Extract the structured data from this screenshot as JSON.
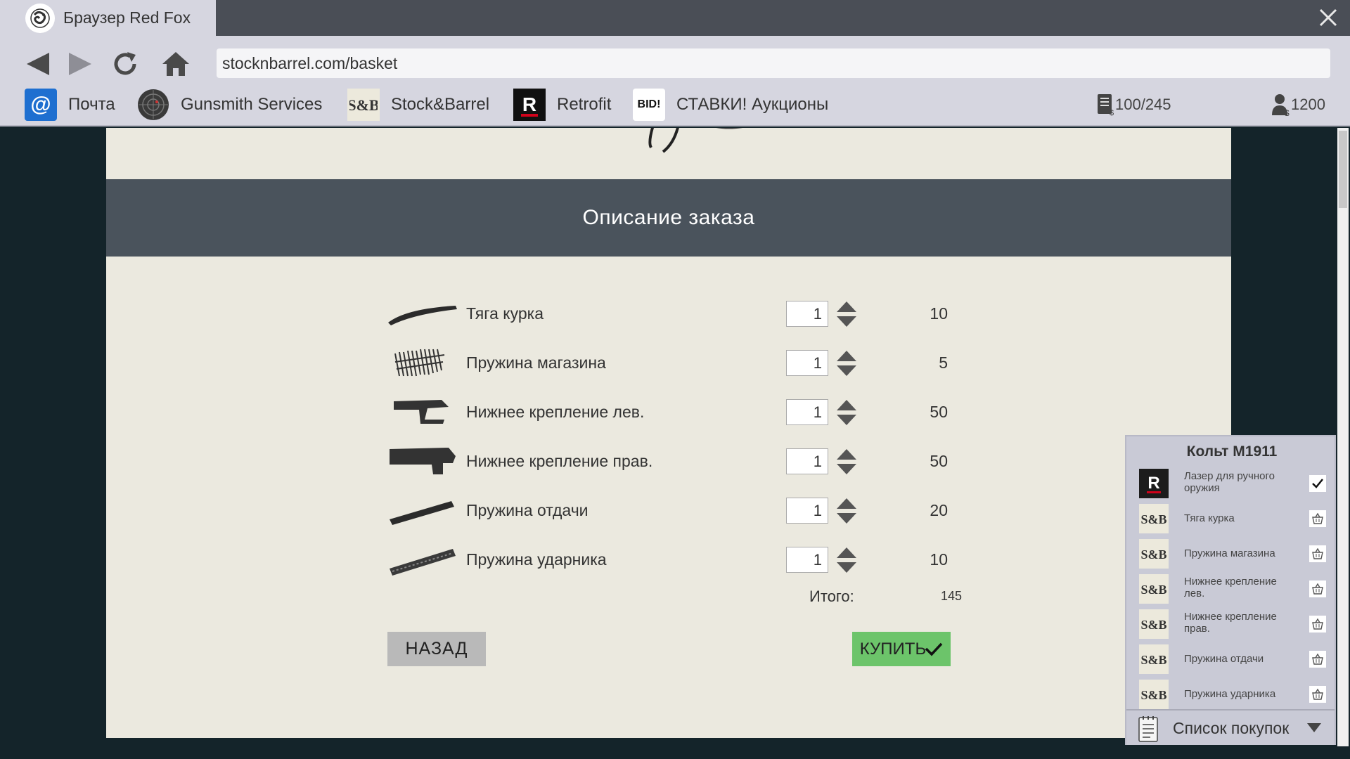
{
  "browser": {
    "tab_title": "Браузер Red Fox",
    "url": "stocknbarrel.com/basket"
  },
  "bookmarks": [
    {
      "label": "Почта",
      "icon": "at-mail-icon"
    },
    {
      "label": "Gunsmith Services",
      "icon": "target-icon"
    },
    {
      "label": "Stock&Barrel",
      "icon": "sb-logo-icon"
    },
    {
      "label": "Retrofit",
      "icon": "retrofit-r-icon"
    },
    {
      "label": "СТАВКИ! Аукционы",
      "icon": "bid-icon",
      "icon_text": "BID!"
    }
  ],
  "stats": {
    "storage": "100/245",
    "money": "1200"
  },
  "order": {
    "title": "Описание заказа",
    "items": [
      {
        "name": "Тяга курка",
        "qty": "1",
        "price": "10"
      },
      {
        "name": "Пружина магазина",
        "qty": "1",
        "price": "5"
      },
      {
        "name": "Нижнее крепление лев.",
        "qty": "1",
        "price": "50"
      },
      {
        "name": "Нижнее крепление прав.",
        "qty": "1",
        "price": "50"
      },
      {
        "name": "Пружина отдачи",
        "qty": "1",
        "price": "20"
      },
      {
        "name": "Пружина ударника",
        "qty": "1",
        "price": "10"
      }
    ],
    "total_label": "Итого:",
    "total_value": "145",
    "back_label": "НАЗАД",
    "buy_label": "КУПИТЬ"
  },
  "shopping_panel": {
    "title": "Кольт M1911",
    "items": [
      {
        "label": "Лазер для ручного оружия",
        "shop": "Retrofit",
        "status": "checked"
      },
      {
        "label": "Тяга курка",
        "shop": "Stock&Barrel",
        "status": "basket"
      },
      {
        "label": "Пружина магазина",
        "shop": "Stock&Barrel",
        "status": "basket"
      },
      {
        "label": "Нижнее крепление лев.",
        "shop": "Stock&Barrel",
        "status": "basket"
      },
      {
        "label": "Нижнее крепление прав.",
        "shop": "Stock&Barrel",
        "status": "basket"
      },
      {
        "label": "Пружина отдачи",
        "shop": "Stock&Barrel",
        "status": "basket"
      },
      {
        "label": "Пружина ударника",
        "shop": "Stock&Barrel",
        "status": "basket"
      }
    ],
    "footer_label": "Список покупок"
  },
  "colors": {
    "buy_button": "#6cc46a",
    "header_band": "#4a535c",
    "page_bg": "#ebe9df",
    "retrofit_red": "#d0021b"
  }
}
